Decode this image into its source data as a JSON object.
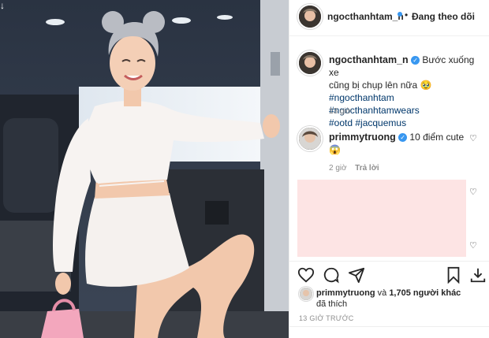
{
  "post": {
    "username": "ngocthanhtam_n",
    "follow_status": "Đang theo dõi",
    "more_label": "···",
    "caption_text": "Bước xuống xe",
    "caption_text2": "cũng bị chụp lên nữa 🥹",
    "hashtags_line1": "#ngocthanhtam #ngocthanhtamwears",
    "hashtags_line2": "#ootd #jacquemus",
    "caption_time": "13 giờ"
  },
  "comments": [
    {
      "username": "primmytruong",
      "text": "10 điểm cute",
      "emoji": "😱",
      "time": "2 giờ",
      "reply_label": "Trả lời"
    }
  ],
  "likes": {
    "first_liker": "primmytruong",
    "text_and": "và",
    "count_text": "1,705 người khác",
    "text_liked": "đã thích"
  },
  "timestamp": "13 GIỜ TRƯỚC",
  "icons": {
    "like": "heart-icon",
    "comment": "comment-icon",
    "share": "share-icon",
    "save": "bookmark-icon",
    "download": "download-icon"
  },
  "colors": {
    "verified": "#3897f0",
    "hashtag": "#00376b",
    "pink_block": "#fde4e4"
  }
}
